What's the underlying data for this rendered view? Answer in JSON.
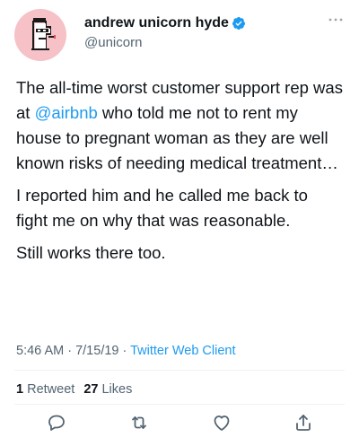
{
  "author": {
    "display_name": "andrew unicorn hyde",
    "handle": "@unicorn",
    "avatar_icon": "pixel-punk-avatar",
    "avatar_bg": "#f6c1c7",
    "verified": true
  },
  "tweet": {
    "p1_before": "The all-time worst customer support rep was at ",
    "p1_mention": "@airbnb",
    "p1_after": " who told me not to rent my house to pregnant woman as they are well known risks of needing medical treatment…",
    "p2": "I reported him and he called me back to fight me on why that was reasonable.",
    "p3": "Still works there too."
  },
  "meta": {
    "time": "5:46 AM",
    "sep1": " · ",
    "date": "7/15/19",
    "sep2": " · ",
    "client": "Twitter Web Client"
  },
  "stats": {
    "retweets_count": "1",
    "retweets_label": " Retweet",
    "likes_count": "27",
    "likes_label": " Likes"
  },
  "actions": [
    "reply-icon",
    "retweet-icon",
    "like-icon",
    "share-icon"
  ],
  "colors": {
    "accent": "#1d9bf0",
    "secondary_text": "#536471",
    "primary_text": "#0f1419"
  }
}
